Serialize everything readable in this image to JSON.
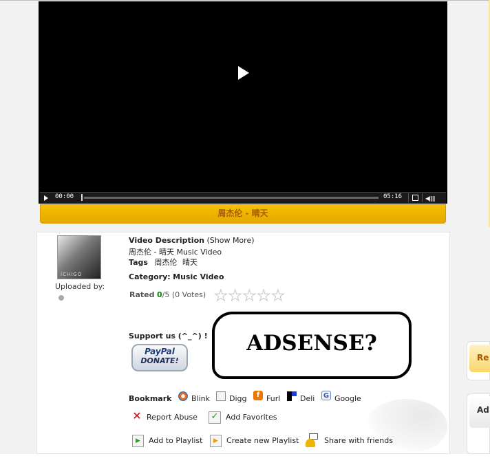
{
  "player": {
    "current_time": "00:00",
    "duration": "05:16",
    "progress": 0,
    "title": "周杰伦 - 晴天"
  },
  "uploader": {
    "avatar_text": "ICHIGO",
    "label": "Uploaded by:"
  },
  "details": {
    "description_label": "Video Description",
    "show_more": "(Show More)",
    "description": "周杰伦 - 晴天 Music Video",
    "tags_label": "Tags",
    "tags": [
      "周杰伦",
      "晴天"
    ],
    "category_label": "Category:",
    "category": "Music Video",
    "rated_label": "Rated",
    "rating_value": "0",
    "rating_max": "/5",
    "votes": "(0 Votes)",
    "stars": 5
  },
  "support": {
    "label": "Support us (^_^) !",
    "paypal_line1": "PayPal",
    "paypal_line2": "DONATE!"
  },
  "ad_placeholder": "ADSENSE?",
  "bookmark": {
    "label": "Bookmark",
    "items": [
      {
        "label": "Blink",
        "icon": "blink-icon"
      },
      {
        "label": "Digg",
        "icon": "digg-icon"
      },
      {
        "label": "Furl",
        "icon": "furl-icon",
        "glyph": "f"
      },
      {
        "label": "Deli",
        "icon": "delicious-icon"
      },
      {
        "label": "Google",
        "icon": "google-icon",
        "glyph": "G"
      }
    ]
  },
  "actions": {
    "report_abuse": "Report Abuse",
    "add_favorites": "Add Favorites",
    "add_to_playlist": "Add to Playlist",
    "create_playlist": "Create new Playlist",
    "share": "Share with friends"
  },
  "sidebar": {
    "widget1_title": "Re",
    "widget2_title": "Ad"
  },
  "colors": {
    "accent": "#f0b400",
    "title_text": "#a35a00",
    "rating_green": "#0a8a00"
  }
}
